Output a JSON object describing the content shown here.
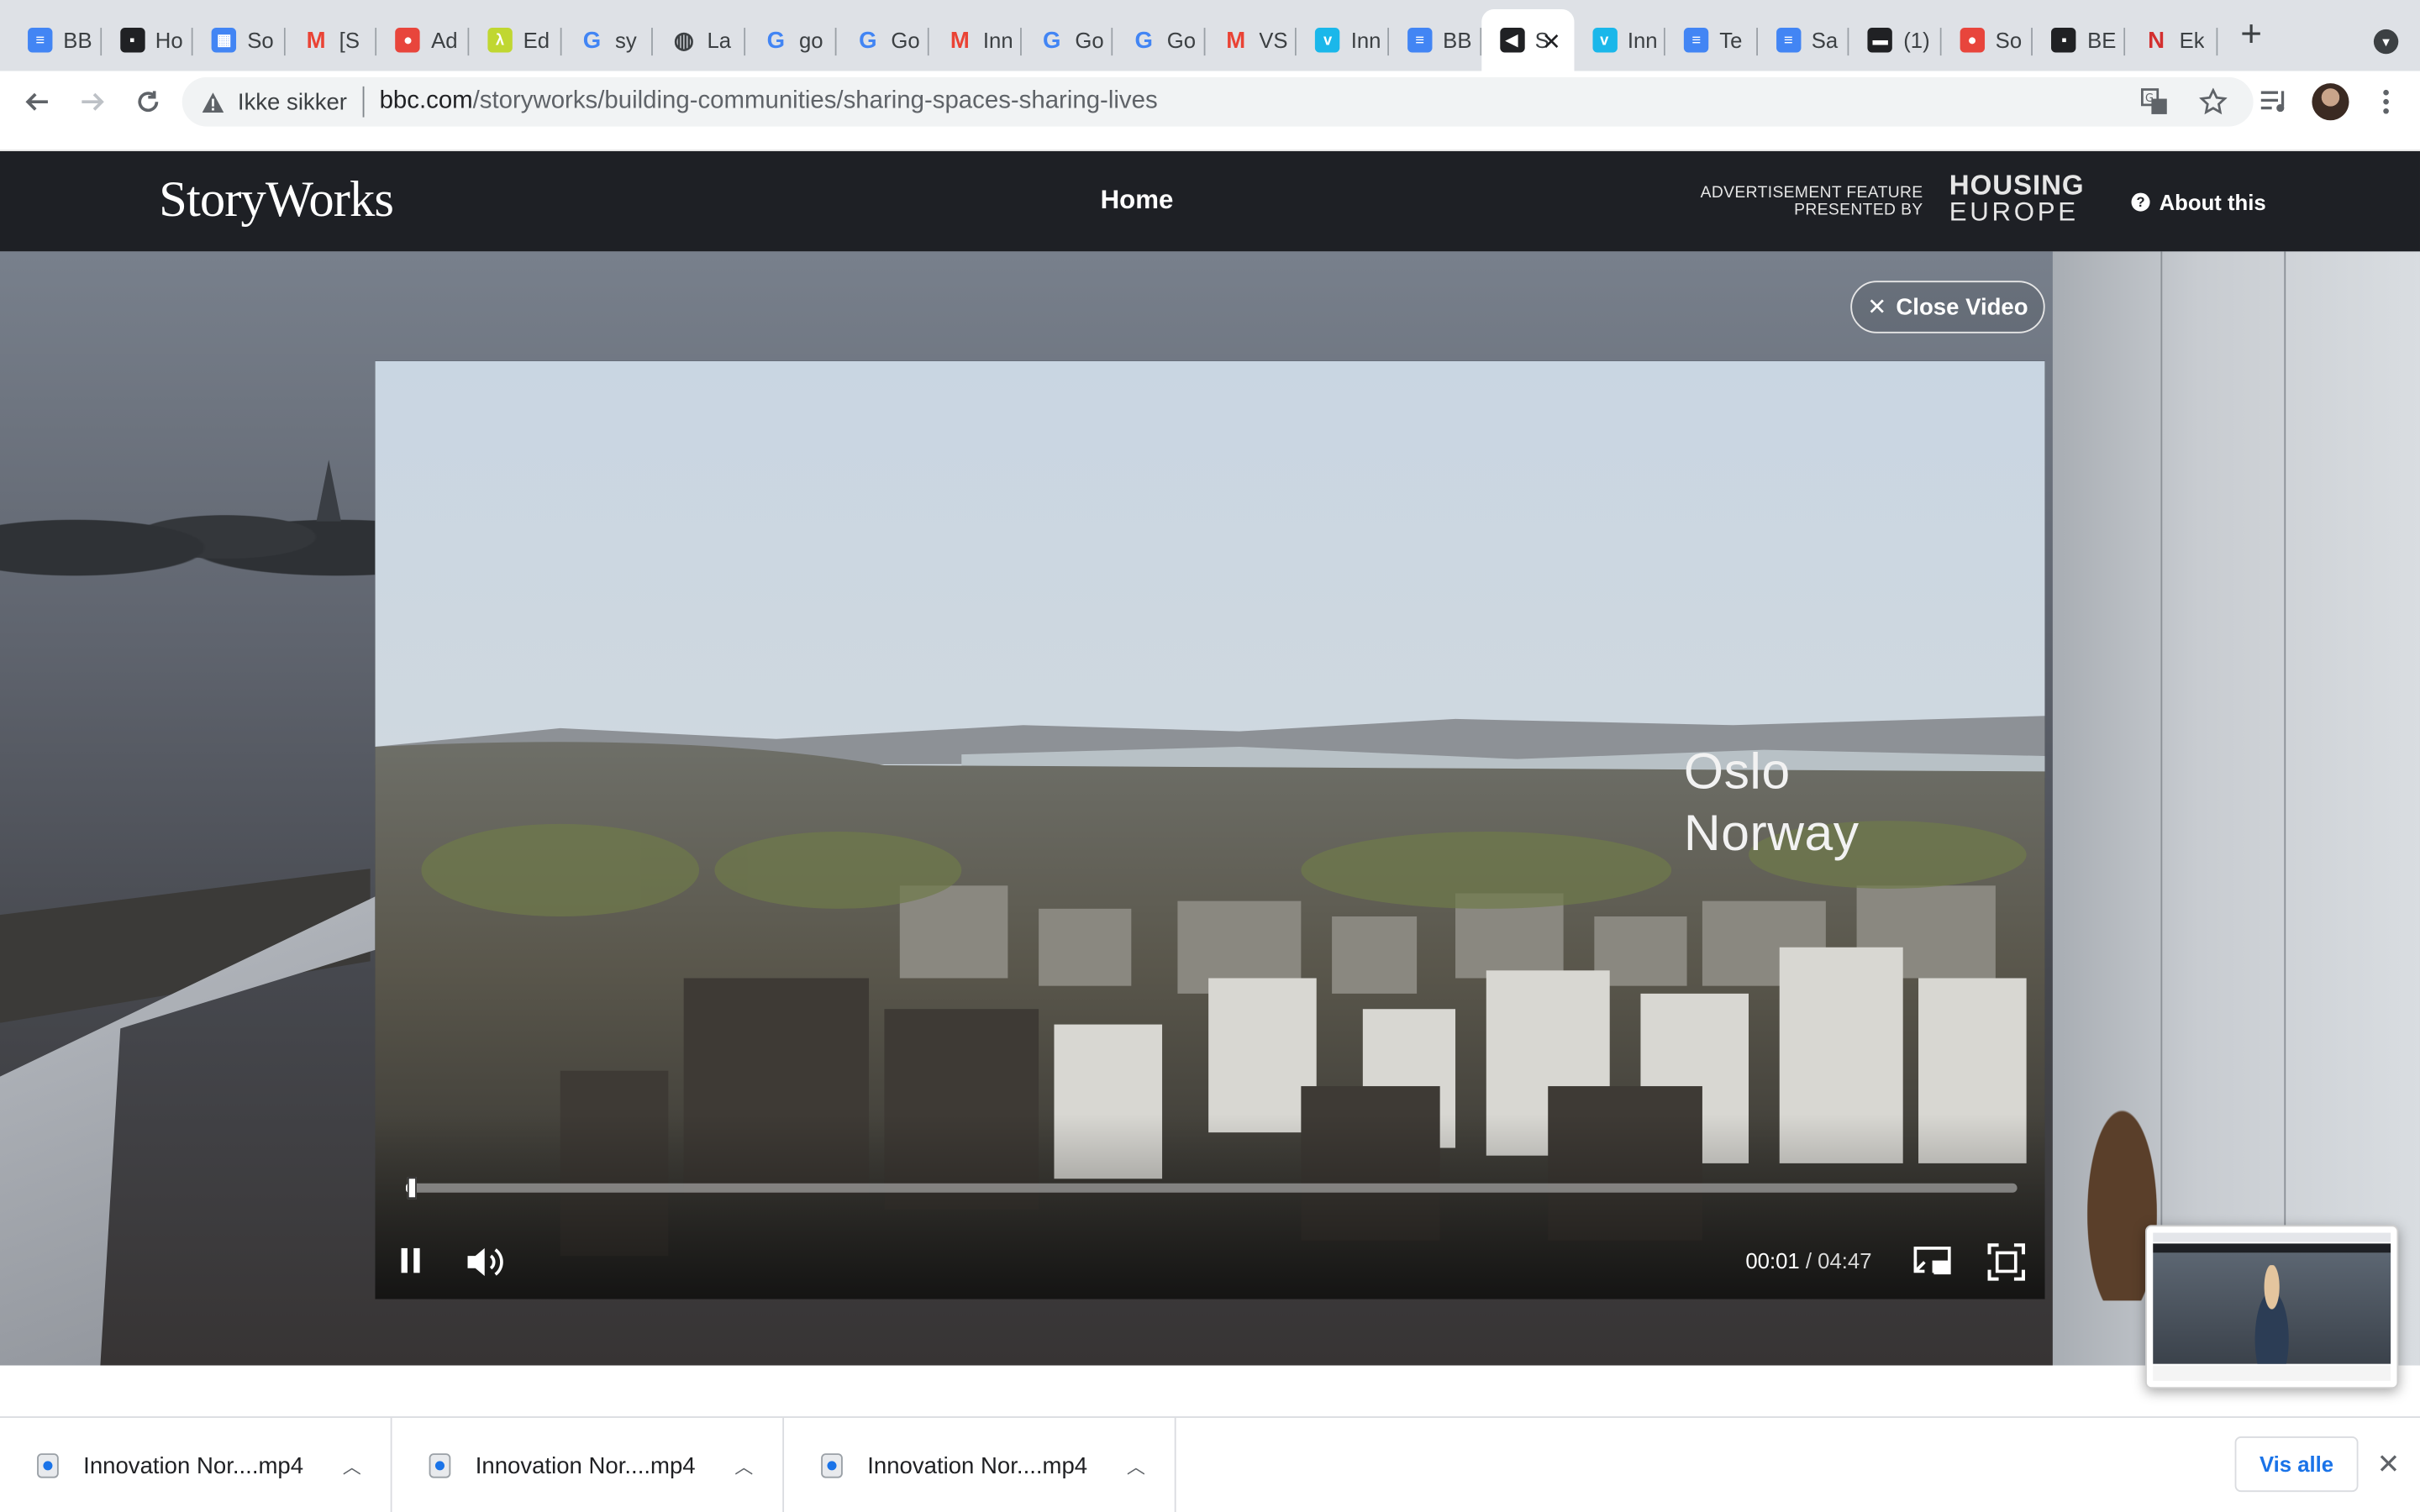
{
  "browser": {
    "tabs": [
      {
        "title": "BB",
        "icon": "google-docs-icon",
        "color": "#4285f4"
      },
      {
        "title": "Ho",
        "icon": "bbc-icon",
        "color": "#202124"
      },
      {
        "title": "So",
        "icon": "google-calendar-icon",
        "color": "#4285f4"
      },
      {
        "title": "[S",
        "icon": "gmail-icon",
        "color": "#ea4335"
      },
      {
        "title": "Ad",
        "icon": "circle-logo-icon",
        "color": "#e8453c"
      },
      {
        "title": "Ed",
        "icon": "lambda-icon",
        "color": "#c0d731"
      },
      {
        "title": "sy",
        "icon": "google-icon",
        "color": "#4285f4"
      },
      {
        "title": "La",
        "icon": "globe-icon",
        "color": "#3c4043"
      },
      {
        "title": "go",
        "icon": "google-icon",
        "color": "#4285f4"
      },
      {
        "title": "Go",
        "icon": "google-icon",
        "color": "#4285f4"
      },
      {
        "title": "Inn",
        "icon": "gmail-icon",
        "color": "#ea4335"
      },
      {
        "title": "Go",
        "icon": "google-icon",
        "color": "#4285f4"
      },
      {
        "title": "Go",
        "icon": "google-icon",
        "color": "#4285f4"
      },
      {
        "title": "VS",
        "icon": "gmail-icon",
        "color": "#ea4335"
      },
      {
        "title": "Inn",
        "icon": "vimeo-icon",
        "color": "#1ab7ea"
      },
      {
        "title": "BB",
        "icon": "google-docs-icon",
        "color": "#4285f4"
      },
      {
        "title": "S",
        "icon": "speaker-icon",
        "color": "#202124",
        "active": true
      },
      {
        "title": "Inn",
        "icon": "vimeo-icon",
        "color": "#1ab7ea"
      },
      {
        "title": "Te",
        "icon": "google-docs-icon",
        "color": "#4285f4"
      },
      {
        "title": "Sa",
        "icon": "google-docs-icon",
        "color": "#4285f4"
      },
      {
        "title": "(1)",
        "icon": "film-icon",
        "color": "#202124"
      },
      {
        "title": "So",
        "icon": "circle-logo-icon",
        "color": "#e8453c"
      },
      {
        "title": "BE",
        "icon": "bbc-icon",
        "color": "#202124"
      },
      {
        "title": "Ek",
        "icon": "n-logo-icon",
        "color": "#d32f2f"
      }
    ],
    "security_label": "Ikke sikker",
    "url_host": "bbc.com",
    "url_path": "/storyworks/building-communities/sharing-spaces-sharing-lives"
  },
  "site": {
    "brand": "StoryWorks",
    "nav_home": "Home",
    "ad_line1": "ADVERTISEMENT FEATURE",
    "ad_line2": "PRESENTED BY",
    "sponsor_line1": "HOUSING",
    "sponsor_line2": "EUROPE",
    "about_label": "About this"
  },
  "video": {
    "close_label": "Close Video",
    "caption_line1": "Oslo",
    "caption_line2": "Norway",
    "current_time": "00:01",
    "separator": "/",
    "total_time": "04:47",
    "progress_fraction": 0.004
  },
  "downloads": {
    "items": [
      {
        "name": "Innovation Nor....mp4"
      },
      {
        "name": "Innovation Nor....mp4"
      },
      {
        "name": "Innovation Nor....mp4"
      }
    ],
    "show_all_label": "Vis alle"
  }
}
